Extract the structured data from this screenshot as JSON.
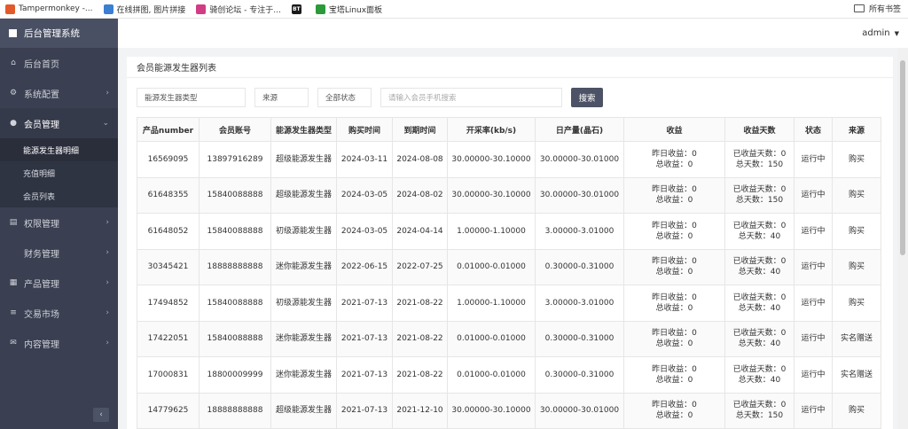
{
  "bookmarks": [
    {
      "label": "Tampermonkey -...",
      "icon": "tampermonkey-icon",
      "color": "#e35a2a"
    },
    {
      "label": "在线拼图, 图片拼接",
      "icon": "puzzle-icon",
      "color": "#3b7fd1"
    },
    {
      "label": "骑创论坛 - 专注于...",
      "icon": "forum-icon",
      "color": "#d23c84"
    },
    {
      "label": "",
      "icon": "bt-icon",
      "color": "#1a1a1a",
      "text": "BT"
    },
    {
      "label": "宝塔Linux面板",
      "icon": "baota-icon",
      "color": "#2a9a3a"
    }
  ],
  "all_bookmarks_label": "所有书签",
  "sidebar": {
    "brand": "后台管理系统",
    "items": [
      {
        "label": "后台首页",
        "icon": "home-icon",
        "glyph": "⌂",
        "chevron": false
      },
      {
        "label": "系统配置",
        "icon": "cogs-icon",
        "glyph": "⚙",
        "chevron": true
      },
      {
        "label": "会员管理",
        "icon": "user-icon",
        "glyph": "●",
        "chevron": true,
        "open": true
      }
    ],
    "subitems": [
      "能源发生器明细",
      "充值明细",
      "会员列表"
    ],
    "items_after": [
      {
        "label": "权限管理",
        "icon": "list-icon",
        "glyph": "▤",
        "chevron": true
      },
      {
        "label": "财务管理",
        "icon": "finance-icon",
        "glyph": "",
        "chevron": true
      },
      {
        "label": "产品管理",
        "icon": "windows-icon",
        "glyph": "▦",
        "chevron": true
      },
      {
        "label": "交易市场",
        "icon": "menu-icon",
        "glyph": "≡",
        "chevron": true
      },
      {
        "label": "内容管理",
        "icon": "envelope-icon",
        "glyph": "✉",
        "chevron": true
      }
    ],
    "collapse": "‹"
  },
  "header": {
    "user": "admin"
  },
  "panel": {
    "title": "会员能源发生器列表",
    "filters": {
      "type_placeholder": "能源发生器类型",
      "source_placeholder": "来源",
      "status_placeholder": "全部状态",
      "search_placeholder": "请输入会员手机搜索",
      "search_button": "搜索"
    }
  },
  "table": {
    "headers": [
      "产品number",
      "会员账号",
      "能源发生器类型",
      "购买时间",
      "到期时间",
      "开采率(kb/s)",
      "日产量(晶石)",
      "收益",
      "收益天数",
      "状态",
      "来源"
    ],
    "rows": [
      {
        "number": "16569095",
        "account": "13897916289",
        "type": "超级能源发生器",
        "buy": "2024-03-11",
        "expire": "2024-08-08",
        "rate": "30.00000-30.10000",
        "daily": "30.00000-30.01000",
        "yesterday": "昨日收益：0",
        "total": "总收益：0",
        "earned_days": "已收益天数：0",
        "total_days": "总天数：150",
        "status": "运行中",
        "source": "购买"
      },
      {
        "number": "61648355",
        "account": "15840088888",
        "type": "超级能源发生器",
        "buy": "2024-03-05",
        "expire": "2024-08-02",
        "rate": "30.00000-30.10000",
        "daily": "30.00000-30.01000",
        "yesterday": "昨日收益：0",
        "total": "总收益：0",
        "earned_days": "已收益天数：0",
        "total_days": "总天数：150",
        "status": "运行中",
        "source": "购买"
      },
      {
        "number": "61648052",
        "account": "15840088888",
        "type": "初级源能发生器",
        "buy": "2024-03-05",
        "expire": "2024-04-14",
        "rate": "1.00000-1.10000",
        "daily": "3.00000-3.01000",
        "yesterday": "昨日收益：0",
        "total": "总收益：0",
        "earned_days": "已收益天数：0",
        "total_days": "总天数：40",
        "status": "运行中",
        "source": "购买"
      },
      {
        "number": "30345421",
        "account": "18888888888",
        "type": "迷你能源发生器",
        "buy": "2022-06-15",
        "expire": "2022-07-25",
        "rate": "0.01000-0.01000",
        "daily": "0.30000-0.31000",
        "yesterday": "昨日收益：0",
        "total": "总收益：0",
        "earned_days": "已收益天数：0",
        "total_days": "总天数：40",
        "status": "运行中",
        "source": "购买"
      },
      {
        "number": "17494852",
        "account": "15840088888",
        "type": "初级源能发生器",
        "buy": "2021-07-13",
        "expire": "2021-08-22",
        "rate": "1.00000-1.10000",
        "daily": "3.00000-3.01000",
        "yesterday": "昨日收益：0",
        "total": "总收益：0",
        "earned_days": "已收益天数：0",
        "total_days": "总天数：40",
        "status": "运行中",
        "source": "购买"
      },
      {
        "number": "17422051",
        "account": "15840088888",
        "type": "迷你能源发生器",
        "buy": "2021-07-13",
        "expire": "2021-08-22",
        "rate": "0.01000-0.01000",
        "daily": "0.30000-0.31000",
        "yesterday": "昨日收益：0",
        "total": "总收益：0",
        "earned_days": "已收益天数：0",
        "total_days": "总天数：40",
        "status": "运行中",
        "source": "实名赠送"
      },
      {
        "number": "17000831",
        "account": "18800009999",
        "type": "迷你能源发生器",
        "buy": "2021-07-13",
        "expire": "2021-08-22",
        "rate": "0.01000-0.01000",
        "daily": "0.30000-0.31000",
        "yesterday": "昨日收益：0",
        "total": "总收益：0",
        "earned_days": "已收益天数：0",
        "total_days": "总天数：40",
        "status": "运行中",
        "source": "实名赠送"
      },
      {
        "number": "14779625",
        "account": "18888888888",
        "type": "超级能源发生器",
        "buy": "2021-07-13",
        "expire": "2021-12-10",
        "rate": "30.00000-30.10000",
        "daily": "30.00000-30.01000",
        "yesterday": "昨日收益：0",
        "total": "总收益：0",
        "earned_days": "已收益天数：0",
        "total_days": "总天数：150",
        "status": "运行中",
        "source": "购买"
      }
    ]
  },
  "colors": {
    "sidebar": "#3a3f51",
    "brand_bar": "#4a5064",
    "search_button": "#4d5366"
  }
}
